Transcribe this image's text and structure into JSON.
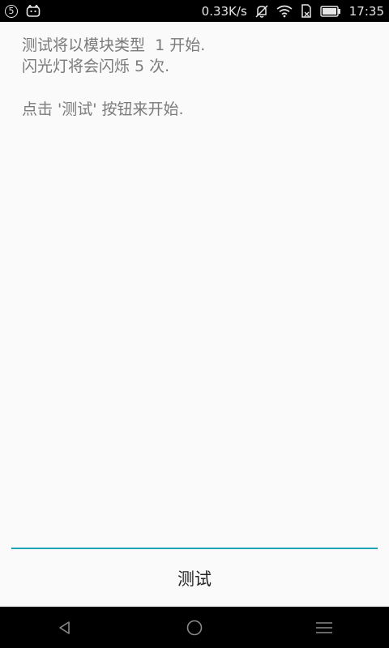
{
  "status_bar": {
    "notification_badge": "5",
    "net_speed": "0.33K/s",
    "time": "17:35",
    "icons": [
      "notification-5-icon",
      "app-notification-icon",
      "mute-icon",
      "wifi-icon",
      "sim-icon",
      "battery-icon"
    ]
  },
  "content": {
    "line1": "测试将以模块类型  1 开始.",
    "line2": "闪光灯将会闪烁 5 次.",
    "line3": "点击 '测试' 按钮来开始."
  },
  "test_button": {
    "label": "测试"
  },
  "colors": {
    "accent": "#1ea4b7",
    "background": "#fafafa",
    "text": "#7a7a7a"
  },
  "nav_bar": {
    "icons": [
      "back-icon",
      "home-icon",
      "menu-icon"
    ]
  }
}
